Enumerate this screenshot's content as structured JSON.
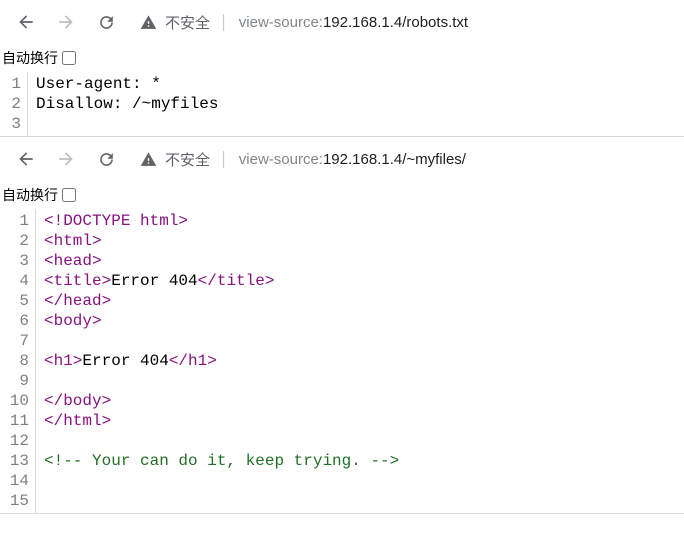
{
  "pane1": {
    "insecure_label": "不安全",
    "url_prefix": "view-source:",
    "url_main": "192.168.1.4/robots.txt",
    "wrap_label": "自动换行",
    "gutter": [
      "1",
      "2",
      "3"
    ],
    "lines": {
      "l1": "User-agent: *",
      "l2": "Disallow: /~myfiles",
      "l3": ""
    }
  },
  "pane2": {
    "insecure_label": "不安全",
    "url_prefix": "view-source:",
    "url_main": "192.168.1.4/~myfiles/",
    "wrap_label": "自动换行",
    "gutter": [
      "1",
      "2",
      "3",
      "4",
      "5",
      "6",
      "7",
      "8",
      "9",
      "10",
      "11",
      "12",
      "13",
      "14",
      "15"
    ],
    "lines": {
      "l1": "<!DOCTYPE html>",
      "l2": "<html>",
      "l3": "<head>",
      "l4_open": "<title>",
      "l4_text": "Error 404",
      "l4_close": "</title>",
      "l5": "</head>",
      "l6": "<body>",
      "l7": "",
      "l8_open": "<h1>",
      "l8_text": "Error 404",
      "l8_close": "</h1>",
      "l9": "",
      "l10": "</body>",
      "l11": "</html>",
      "l12": "",
      "l13": "<!-- Your can do it, keep trying. -->",
      "l14": "",
      "l15": ""
    }
  }
}
